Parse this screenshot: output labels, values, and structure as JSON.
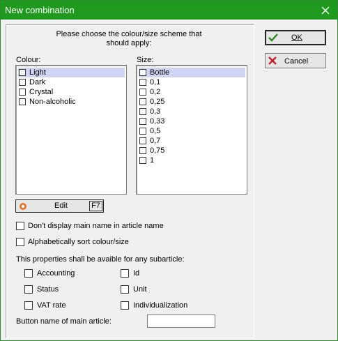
{
  "window": {
    "title": "New combination"
  },
  "intro": {
    "line1": "Please choose the colour/size scheme that",
    "line2": "should apply:"
  },
  "colour": {
    "label": "Colour:",
    "items": [
      "Light",
      "Dark",
      "Crystal",
      "Non-alcoholic"
    ]
  },
  "size": {
    "label": "Size:",
    "items": [
      "Bottle",
      "0,1",
      "0,2",
      "0,25",
      "0,3",
      "0,33",
      "0,5",
      "0,7",
      "0,75",
      "1"
    ]
  },
  "edit_button": {
    "label": "Edit",
    "shortcut": "F7"
  },
  "options": {
    "dont_display": "Don't display main name in article name",
    "alpha_sort": "Alphabetically sort colour/size"
  },
  "subarticle": {
    "heading": "This properties shall be avaible for any subarticle:",
    "accounting": "Accounting",
    "id": "Id",
    "status": "Status",
    "unit": "Unit",
    "vat": "VAT rate",
    "individualization": "Individualization"
  },
  "button_name": {
    "label": "Button name of main article:",
    "value": ""
  },
  "ok_button": {
    "label": "OK"
  },
  "cancel_button": {
    "label": "Cancel"
  },
  "colors": {
    "titlebar": "#1f9a1f",
    "ok_check": "#2a8a1f",
    "cancel_x": "#c0202a",
    "edit_icon": "#e8742a",
    "selection": "#cfd4f3"
  }
}
